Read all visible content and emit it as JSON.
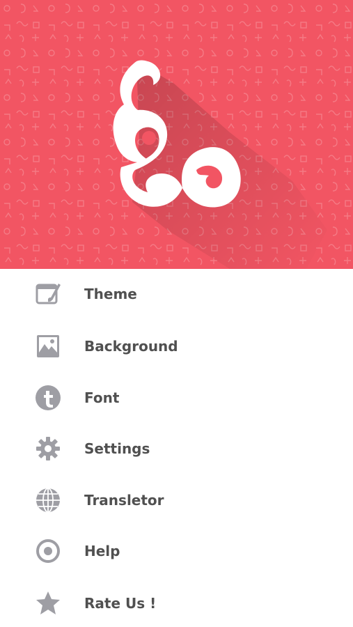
{
  "header": {
    "background_color": "#f25563",
    "logo": "telugu-letter-logo"
  },
  "menu": {
    "icon_color": "#9e9ea4",
    "text_color": "#505050",
    "items": [
      {
        "label": "Theme",
        "icon": "theme-icon"
      },
      {
        "label": "Background",
        "icon": "image-icon"
      },
      {
        "label": "Font",
        "icon": "font-icon"
      },
      {
        "label": "Settings",
        "icon": "gear-icon"
      },
      {
        "label": "Transletor",
        "icon": "globe-icon"
      },
      {
        "label": "Help",
        "icon": "help-icon"
      },
      {
        "label": "Rate Us !",
        "icon": "star-icon"
      }
    ]
  }
}
